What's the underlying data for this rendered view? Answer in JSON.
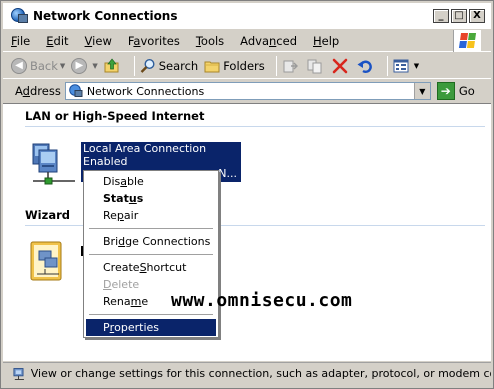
{
  "window": {
    "title": "Network Connections",
    "minimize_glyph": "_",
    "maximize_glyph": "□",
    "close_glyph": "X"
  },
  "menu": {
    "items": [
      {
        "ul": "F",
        "rest": "ile"
      },
      {
        "ul": "E",
        "rest": "dit"
      },
      {
        "ul": "V",
        "rest": "iew"
      },
      {
        "pre": "F",
        "ul": "a",
        "rest": "vorites"
      },
      {
        "ul": "T",
        "rest": "ools"
      },
      {
        "pre": "Adva",
        "ul": "n",
        "rest": "ced"
      },
      {
        "ul": "H",
        "rest": "elp"
      }
    ]
  },
  "toolbar": {
    "back_label": "Back",
    "search_label": "Search",
    "folders_label": "Folders"
  },
  "address": {
    "label_ul": "d",
    "label_pre": "A",
    "label_rest": "dress",
    "value": "Network Connections",
    "go_label": "Go"
  },
  "content": {
    "group_lan": "LAN or High-Speed Internet",
    "group_wizard": "Wizard",
    "connection_name": "Local Area Connection",
    "connection_status": "Enabled",
    "connection_device_partial": "N..."
  },
  "context_menu": {
    "items": [
      {
        "pre": "Dis",
        "ul": "a",
        "rest": "ble",
        "style": "normal"
      },
      {
        "pre": "Stat",
        "ul": "u",
        "rest": "s",
        "style": "bold"
      },
      {
        "pre": "Re",
        "ul": "p",
        "rest": "air",
        "style": "normal"
      },
      {
        "separator": true
      },
      {
        "pre": "Bri",
        "ul": "d",
        "rest": "ge Connections",
        "style": "normal"
      },
      {
        "separator": true
      },
      {
        "pre": "Create ",
        "ul": "S",
        "rest": "hortcut",
        "style": "normal"
      },
      {
        "pre": "",
        "ul": "D",
        "rest": "elete",
        "style": "disabled"
      },
      {
        "pre": "Rena",
        "ul": "m",
        "rest": "e",
        "style": "normal"
      },
      {
        "separator": true
      },
      {
        "pre": "P",
        "ul": "r",
        "rest": "operties",
        "style": "highlight"
      }
    ]
  },
  "watermark": "www.omnisecu.com",
  "statusbar": {
    "text": "View or change settings for this connection, such as adapter, protocol, or modem configura"
  },
  "colors": {
    "selection": "#0a246a",
    "chrome": "#d4d0c8"
  }
}
